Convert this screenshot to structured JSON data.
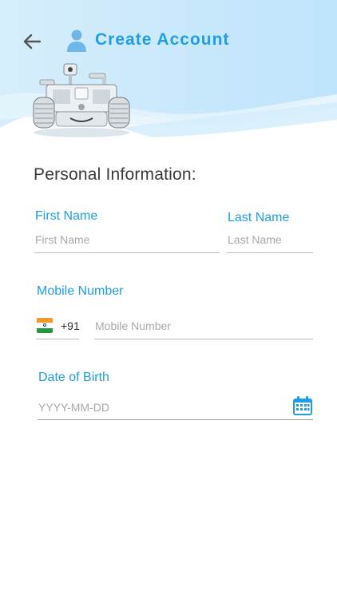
{
  "header": {
    "title": "Create Account"
  },
  "icons": {
    "back": "arrow-left-icon",
    "user": "user-icon",
    "calendar": "calendar-icon",
    "flag": "india-flag-icon"
  },
  "colors": {
    "accent": "#1e9ee8",
    "header_bg": "#c8e7fb",
    "heading_text": "#3a3a3a",
    "placeholder": "#a8a8a8"
  },
  "form": {
    "section_title": "Personal Information:",
    "first_name": {
      "label": "First Name",
      "placeholder": "First Name",
      "value": ""
    },
    "last_name": {
      "label": "Last Name",
      "placeholder": "Last Name",
      "value": ""
    },
    "mobile": {
      "label": "Mobile Number",
      "country_code": "+91",
      "placeholder": "Mobile Number",
      "value": ""
    },
    "dob": {
      "label": "Date of Birth",
      "placeholder": "YYYY-MM-DD",
      "value": ""
    }
  }
}
